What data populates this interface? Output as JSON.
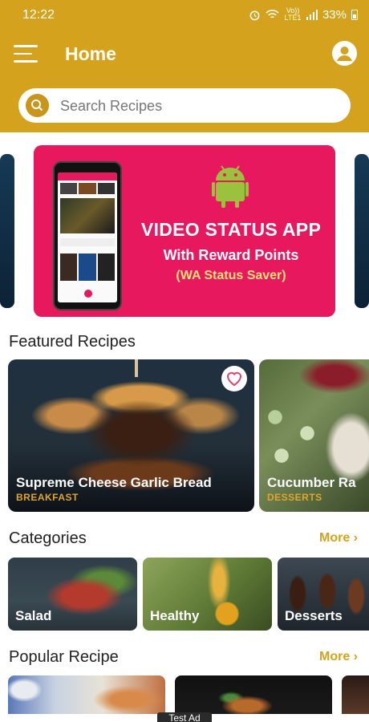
{
  "status_bar": {
    "time": "12:22",
    "network": "Vo)) LTE1",
    "battery": "33%"
  },
  "header": {
    "title": "Home"
  },
  "search": {
    "placeholder": "Search Recipes"
  },
  "banner": {
    "line1": "VIDEO STATUS APP",
    "line2": "With Reward Points",
    "line3": "(WA Status Saver)"
  },
  "featured": {
    "title": "Featured Recipes",
    "items": [
      {
        "name": "Supreme Cheese Garlic Bread",
        "category": "BREAKFAST"
      },
      {
        "name": "Cucumber Ra",
        "category": "DESSERTS"
      }
    ]
  },
  "categories": {
    "title": "Categories",
    "more": "More",
    "items": [
      {
        "label": "Salad"
      },
      {
        "label": "Healthy"
      },
      {
        "label": "Desserts"
      }
    ]
  },
  "popular": {
    "title": "Popular Recipe",
    "more": "More"
  },
  "ad": {
    "label": "Test Ad"
  },
  "colors": {
    "header": "#D4A21C",
    "accent": "#D4A21C",
    "banner": "#E8185E"
  }
}
